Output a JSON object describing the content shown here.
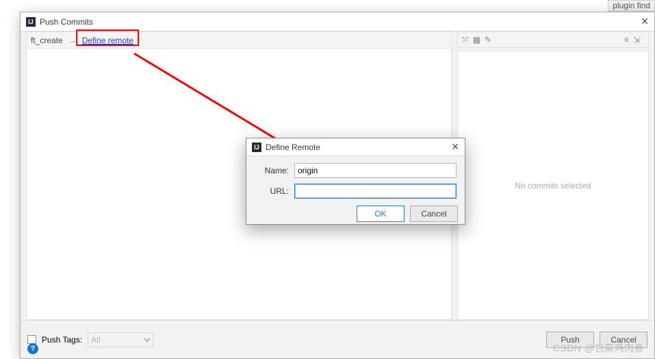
{
  "bg_tab": "plugin  find",
  "main": {
    "title": "Push Commits",
    "left": {
      "branch": "ft_create",
      "arrow": "→",
      "define_remote": "Define remote"
    },
    "right": {
      "placeholder": "No commits selected"
    },
    "footer": {
      "push_tags_label": "Push Tags:",
      "tags_value": "All",
      "push_btn": "Push",
      "cancel_btn": "Cancel"
    }
  },
  "inner": {
    "title": "Define Remote",
    "name_label": "Name:",
    "url_label": "URL:",
    "name_value": "origin",
    "url_value": "",
    "ok": "OK",
    "cancel": "Cancel"
  },
  "watermark": "CSDN @包菜鸡肉卷"
}
